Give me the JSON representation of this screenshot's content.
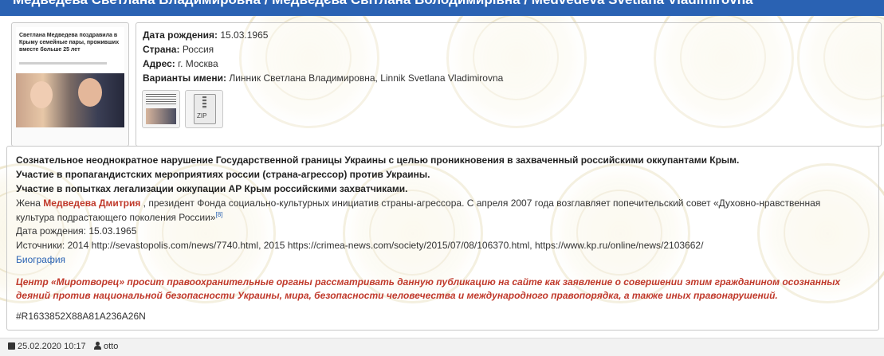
{
  "header": {
    "title": "Медведева Светлана Владимировна / Медведєва Світлана Володимирівна / Medvedeva Svetlana Vladimirovna"
  },
  "profile": {
    "photo_headline": "Светлана Медведева поздравила в Крыму семейные пары, проживших вместе больше 25 лет",
    "birth_label": "Дата рождения:",
    "birth_value": "15.03.1965",
    "country_label": "Страна:",
    "country_value": "Россия",
    "address_label": "Адрес:",
    "address_value": "г. Москва",
    "names_label": "Варианты имени:",
    "names_value": "Линник Светлана Владимировна, Linnik Svetlana Vladimirovna",
    "zip_label": "ZIP"
  },
  "description": {
    "line1": "Сознательное неоднократное нарушение Государственной границы Украины с целью проникновения в захваченный российскими оккупантами Крым.",
    "line2": "Участие в пропагандистских мероприятиях россии (страна-агрессор) против Украины.",
    "line3": "Участие в попытках легализации оккупации АР Крым российскими захватчиками.",
    "wife_prefix": "Жена ",
    "wife_name": "Медведева Дмитрия",
    "wife_text": " , президент Фонда социально-культурных инициатив страны-агрессора. С апреля 2007 года возглавляет попечительский совет «Духовно-нравственная",
    "wife_text2": "культура подрастающего поколения России»",
    "footnote": "[8]",
    "birth": "Дата рождения: 15.03.1965",
    "sources_prefix": "Источники: 2014 ",
    "source1": "http://sevastopolis.com/news/7740.html",
    "sources_mid1": ", 2015 ",
    "source2": "https://crimea-news.com/society/2015/07/08/106370.html",
    "sources_mid2": ", ",
    "source3": "https://www.kp.ru/online/news/2103662/",
    "biography_link": "Биография",
    "warning": "Центр «Миротворец» просит правоохранительные органы рассматривать данную публикацию на сайте как заявление о совершении этим гражданином осознанных деяний против национальной безопасности Украины, мира, безопасности человечества и международного правопорядка, а также иных правонарушений.",
    "record_id": "#R1633852X88A81A236A26N"
  },
  "footer": {
    "date": "25.02.2020 10:17",
    "author": "otto"
  },
  "watermark": {
    "text": "МИРОТВОРЕЦЬ PRO BONO PUBLICO"
  }
}
